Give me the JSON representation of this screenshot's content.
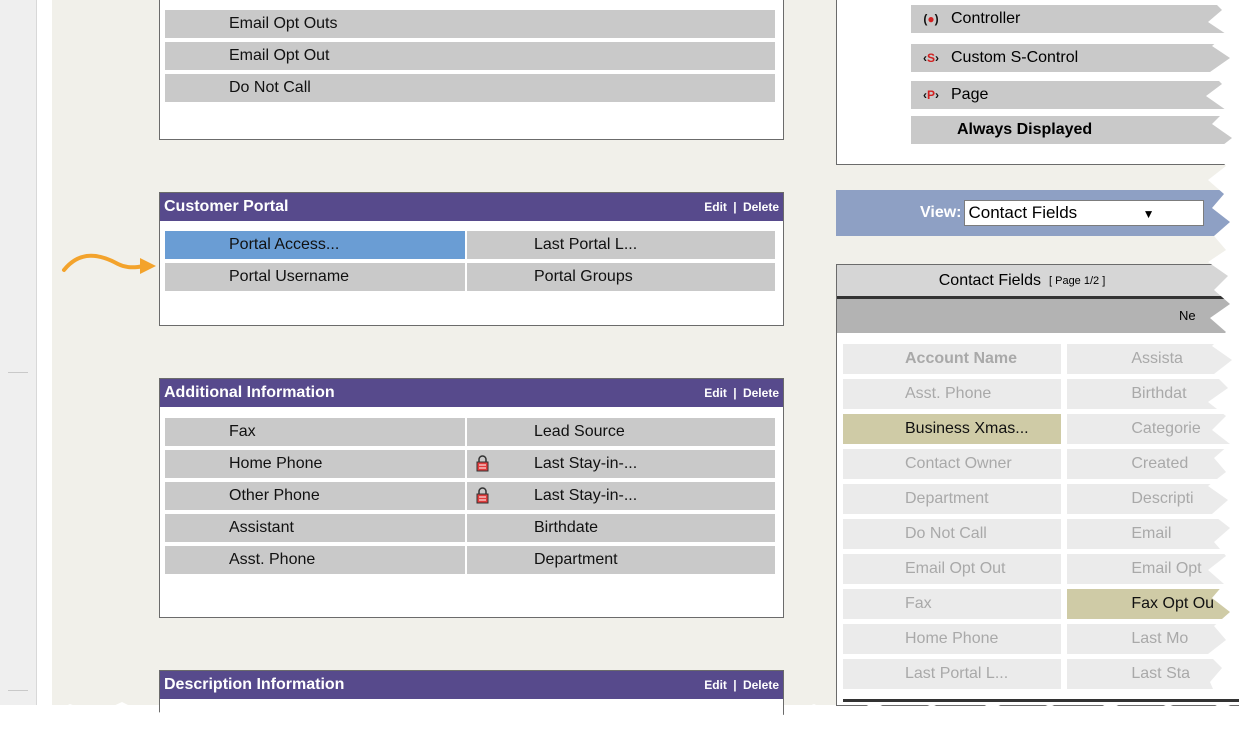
{
  "top_section": {
    "rows": [
      {
        "left": "Email Opt Outs"
      },
      {
        "left": "Email Opt Out"
      },
      {
        "left": "Do Not Call"
      }
    ]
  },
  "customer_portal": {
    "title": "Customer Portal",
    "edit": "Edit",
    "separator": "|",
    "delete": "Delete",
    "rows": [
      {
        "left": "Portal Access...",
        "right": "Last Portal L..."
      },
      {
        "left": "Portal Username",
        "right": "Portal Groups"
      }
    ]
  },
  "additional_information": {
    "title": "Additional Information",
    "edit": "Edit",
    "separator": "|",
    "delete": "Delete",
    "rows": [
      {
        "left": "Fax",
        "right": "Lead Source"
      },
      {
        "left": "Home Phone",
        "right": "Last Stay-in-..."
      },
      {
        "left": "Other Phone",
        "right": "Last Stay-in-..."
      },
      {
        "left": "Assistant",
        "right": "Birthdate"
      },
      {
        "left": "Asst. Phone",
        "right": "Department"
      }
    ]
  },
  "description_information": {
    "title": "Description Information",
    "edit": "Edit",
    "separator": "|",
    "delete": "Delete"
  },
  "legend": {
    "controller": "Controller",
    "custom_s_control": "Custom S-Control",
    "page": "Page",
    "always_displayed": "Always Displayed",
    "glyph_s": "S",
    "glyph_p": "P"
  },
  "view": {
    "label": "View:",
    "selected": "Contact Fields"
  },
  "palette": {
    "title": "Contact Fields",
    "page": "[ Page 1/2 ]",
    "next": "Ne",
    "rows": [
      {
        "left": "Account Name",
        "right": "Assista"
      },
      {
        "left": "Asst. Phone",
        "right": "Birthdat"
      },
      {
        "left": "Business Xmas...",
        "right": "Categorie"
      },
      {
        "left": "Contact Owner",
        "right": "Created"
      },
      {
        "left": "Department",
        "right": "Descripti"
      },
      {
        "left": "Do Not Call",
        "right": "Email"
      },
      {
        "left": "Email Opt Out",
        "right": "Email Opt"
      },
      {
        "left": "Fax",
        "right": "Fax Opt Ou"
      },
      {
        "left": "Home Phone",
        "right": "Last Mo"
      },
      {
        "left": "Last Portal L...",
        "right": "Last Sta"
      }
    ]
  },
  "colors": {
    "section_header": "#574a8c",
    "field_cell": "#c9c9c9",
    "selected_field": "#6a9dd4",
    "used_field": "#cfcba6",
    "view_bar": "#8ea0c4",
    "arrow": "#f3a32c"
  },
  "icons": {
    "lock": "padlock-icon",
    "arrow": "curved-arrow-icon"
  }
}
